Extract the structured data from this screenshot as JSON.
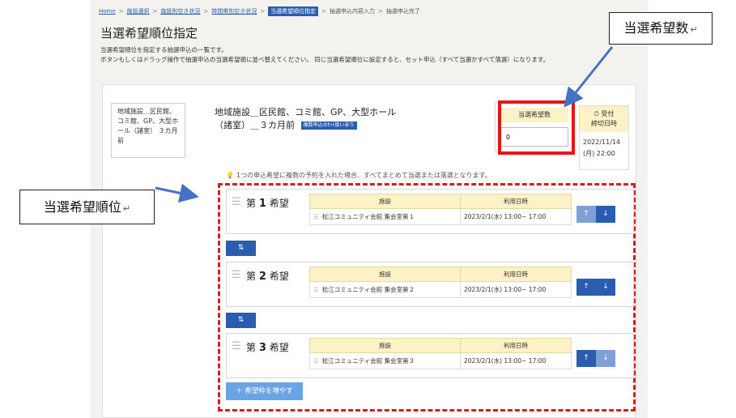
{
  "breadcrumb": {
    "home": "Home",
    "facility_select": "施設選択",
    "facility_availability": "施設別空き状況",
    "time_availability": "時間帯別空き状況",
    "current": "当選希望順位指定",
    "lottery_input": "抽選申込内容入力",
    "lottery_done": "抽選申込完了"
  },
  "page_title": "当選希望順位指定",
  "description_line1": "当選希望順位を指定する抽選申込の一覧です。",
  "description_line2": "ボタンもしくはドラッグ操作で抽選申込の当選希望順に並べ替えてください。 同じ当選希望順位に設定すると、セット申込（すべて当選かすべて落選）になります。",
  "side_card_text": "地域施設＿区民館、コミ館、GP、大型ホール（諸室） ３カ月前",
  "facility_title": "地域施設＿区民館、コミ館、GP、大型ホール（諸室）＿３カ月前",
  "set_badge": "複数申込のｾｯﾄ扱いあり",
  "win_count": {
    "header": "当選希望数",
    "value": "0"
  },
  "deadline": {
    "header_line1": "受付",
    "header_line2": "締切日時",
    "date": "2022/11/14",
    "time": "(月) 22:00"
  },
  "note": "1つの申込希望に複数の予約を入れた場合、すべてまとめて当選または落選となります。",
  "table_headers": {
    "facility": "施設",
    "datetime": "利用日時"
  },
  "preferences": [
    {
      "prefix": "第",
      "number": "1",
      "suffix": "希望",
      "facility": "松江コミュニティ会館 集会室第１",
      "datetime": "2023/2/1(水) 13:00~ 17:00"
    },
    {
      "prefix": "第",
      "number": "2",
      "suffix": "希望",
      "facility": "松江コミュニティ会館 集会室第２",
      "datetime": "2023/2/1(水) 13:00~ 17:00"
    },
    {
      "prefix": "第",
      "number": "3",
      "suffix": "希望",
      "facility": "松江コミュニティ会館 集会室第３",
      "datetime": "2023/2/1(水) 13:00~ 17:00"
    }
  ],
  "add_button": "＋ 希望枠を増やす",
  "callouts": {
    "win_count": "当選希望数",
    "priority": "当選希望順位",
    "return_mark": "↵"
  },
  "colors": {
    "accent": "#2a5db0",
    "header_bg": "#fdf1c6",
    "highlight_red": "#e8141a"
  }
}
